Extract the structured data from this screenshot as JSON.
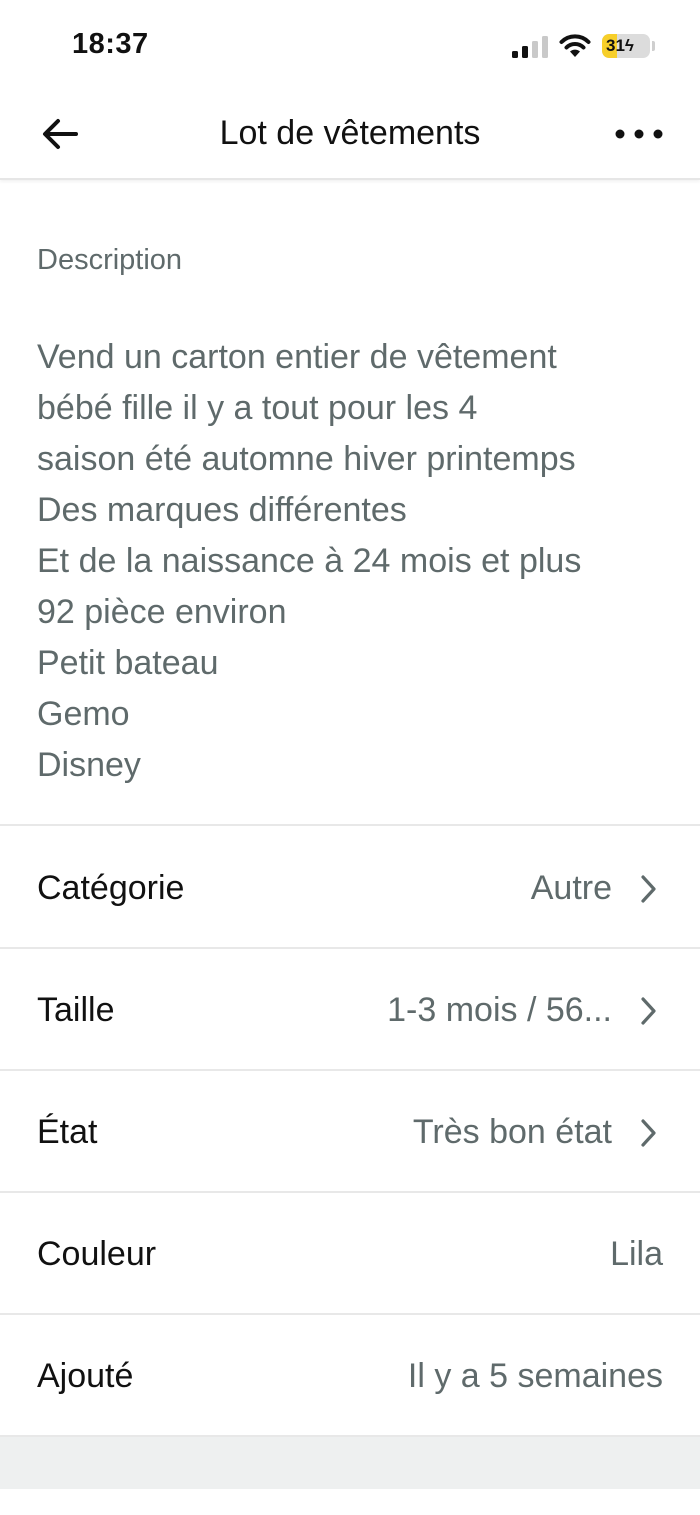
{
  "status_bar": {
    "time": "18:37",
    "battery_label": "31",
    "battery_level": 0.31,
    "icons": [
      "signal-icon",
      "wifi-icon",
      "battery-charging-icon"
    ]
  },
  "nav": {
    "title": "Lot de vêtements",
    "back_icon": "arrow-left-icon",
    "more_icon": "more-horizontal-icon"
  },
  "description": {
    "label": "Description",
    "lines": [
      "Vend un carton entier de vêtement",
      "bébé fille  il y a tout pour les 4",
      "saison été automne hiver printemps",
      "Des marques différentes",
      "Et de la naissance à 24 mois et plus",
      "92 pièce environ",
      "Petit bateau",
      "Gemo",
      "Disney"
    ]
  },
  "attributes": [
    {
      "label": "Catégorie",
      "value": "Autre",
      "has_chevron": true
    },
    {
      "label": "Taille",
      "value": "1-3 mois / 56...",
      "has_chevron": true
    },
    {
      "label": "État",
      "value": "Très bon état",
      "has_chevron": true
    },
    {
      "label": "Couleur",
      "value": "Lila",
      "has_chevron": false
    },
    {
      "label": "Ajouté",
      "value": "Il y a 5 semaines",
      "has_chevron": false
    }
  ],
  "colors": {
    "text_primary": "#111111",
    "text_secondary": "#5f6a6b",
    "divider": "#e8e8e8",
    "battery_accent": "#f7cf2a",
    "bottom_band": "#eef0f0"
  }
}
